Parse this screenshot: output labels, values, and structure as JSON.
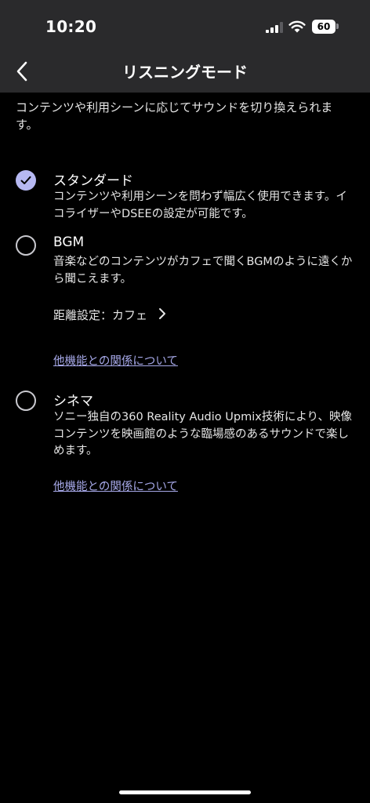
{
  "status_bar": {
    "time": "10:20",
    "battery": "60",
    "icons": [
      "signal-icon",
      "wifi-icon",
      "battery-icon"
    ]
  },
  "nav": {
    "title": "リスニングモード",
    "back_icon": "chevron-left-icon"
  },
  "description": "コンテンツや利用シーンに応じてサウンドを切り換えられます。",
  "options": [
    {
      "title": "スタンダード",
      "description": "コンテンツや利用シーンを問わず幅広く使用できます。イコライザーやDSEEの設定が可能です。",
      "selected": true
    },
    {
      "title": "BGM",
      "description": "音楽などのコンテンツがカフェで聞くBGMのように遠くから聞こえます。",
      "distance_setting": "距離設定：カフェ",
      "link": "他機能との関係について",
      "selected": false
    },
    {
      "title": "シネマ",
      "description": "ソニー独自の360 Reality Audio Upmix技術により、映像コンテンツを映画館のような臨場感のあるサウンドで楽しめます。",
      "link": "他機能との関係について",
      "selected": false
    }
  ],
  "colors": {
    "header_bg": "#2a2a2c",
    "background": "#000000",
    "accent": "#b6b8f2",
    "link": "#a6a8e8"
  }
}
